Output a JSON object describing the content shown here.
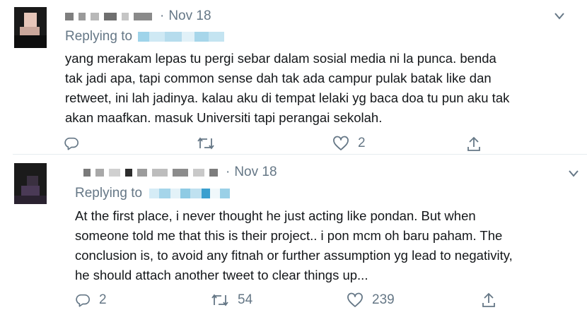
{
  "tweets": [
    {
      "date": "Nov 18",
      "replying_to": "Replying to",
      "lines": [
        "yang merakam lepas tu pergi sebar dalam sosial media ni la punca. benda",
        "tak jadi apa, tapi common sense dah tak ada campur pulak batak like dan",
        "retweet, ini lah jadinya. kalau aku di tempat lelaki yg baca doa tu pun aku tak",
        "akan maafkan. masuk Universiti tapi perangai sekolah."
      ],
      "actions": {
        "reply_count": "",
        "retweet_count": "",
        "like_count": "2"
      }
    },
    {
      "date": "Nov 18",
      "replying_to": "Replying to",
      "lines": [
        "At the first place, i never thought he just acting like pondan. But when",
        "someone told me that this is their project.. i pon mcm oh baru paham. The",
        "conclusion is, to avoid any fitnah or further assumption yg lead to negativity,",
        "he should attach another tweet to clear things up..."
      ],
      "actions": {
        "reply_count": "2",
        "retweet_count": "54",
        "like_count": "239"
      }
    }
  ],
  "icons": [
    "reply-icon",
    "retweet-icon",
    "like-icon",
    "share-icon",
    "chevron-down-icon"
  ],
  "colors": {
    "secondary_text": "#657786",
    "handle_blur": "#9fd4ea",
    "divider": "#e6ecf0"
  }
}
